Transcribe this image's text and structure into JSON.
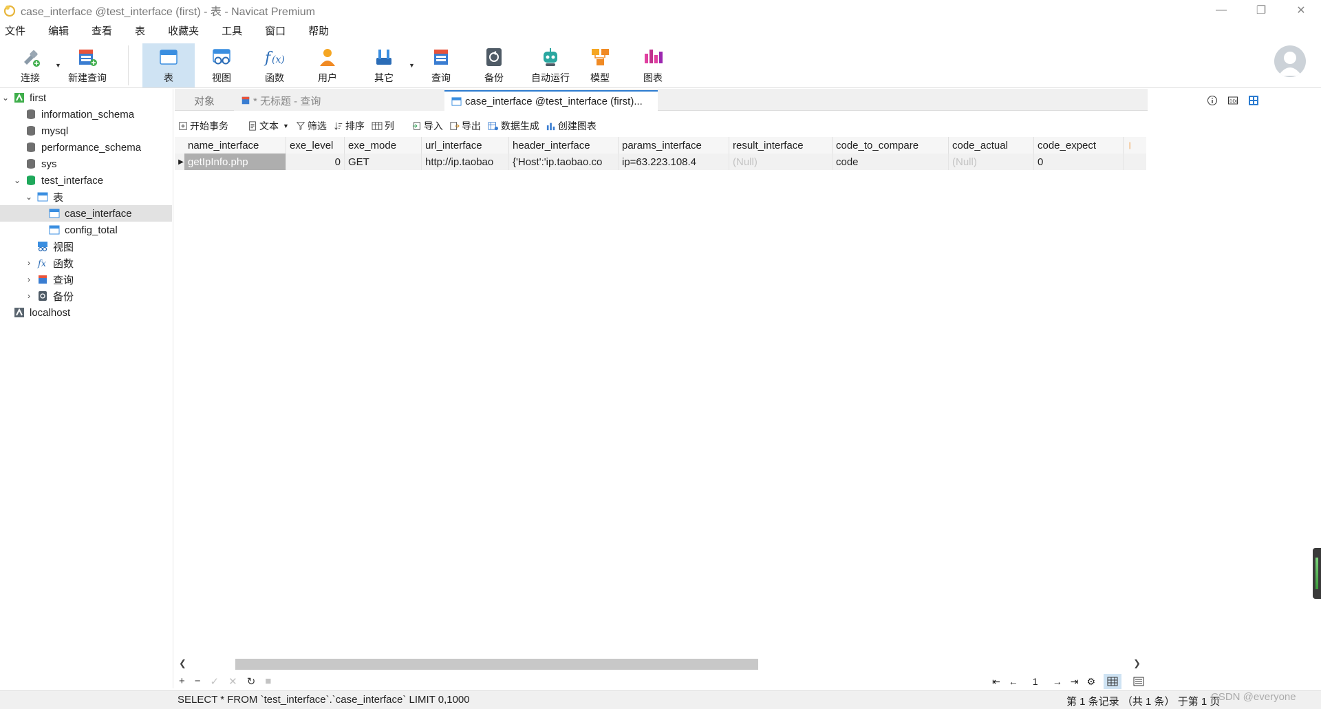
{
  "window": {
    "title": "case_interface @test_interface (first) - 表 - Navicat Premium",
    "controls": [
      "minimize",
      "restore",
      "close"
    ]
  },
  "menu": [
    "文件",
    "编辑",
    "查看",
    "表",
    "收藏夹",
    "工具",
    "窗口",
    "帮助"
  ],
  "toolbar": {
    "connect": "连接",
    "new_query": "新建查询",
    "table": "表",
    "view": "视图",
    "function": "函数",
    "user": "用户",
    "other": "其它",
    "query": "查询",
    "backup": "备份",
    "auto_run": "自动运行",
    "model": "模型",
    "chart": "图表"
  },
  "sidebar": {
    "nodes": [
      {
        "label": "first",
        "icon": "connection-icon",
        "expanded": true
      },
      {
        "label": "information_schema",
        "icon": "database-icon"
      },
      {
        "label": "mysql",
        "icon": "database-icon"
      },
      {
        "label": "performance_schema",
        "icon": "database-icon"
      },
      {
        "label": "sys",
        "icon": "database-icon"
      },
      {
        "label": "test_interface",
        "icon": "database-icon",
        "expanded": true
      },
      {
        "label": "表",
        "icon": "tables-folder-icon",
        "expanded": true
      },
      {
        "label": "case_interface",
        "icon": "table-icon",
        "selected": true
      },
      {
        "label": "config_total",
        "icon": "table-icon"
      },
      {
        "label": "视图",
        "icon": "views-folder-icon"
      },
      {
        "label": "函数",
        "icon": "functions-folder-icon"
      },
      {
        "label": "查询",
        "icon": "queries-folder-icon"
      },
      {
        "label": "备份",
        "icon": "backups-folder-icon"
      },
      {
        "label": "localhost",
        "icon": "connection-icon"
      }
    ]
  },
  "tabs": {
    "objects": "对象",
    "untitled": "* 无标题 - 查询",
    "active": "case_interface @test_interface (first)..."
  },
  "subtoolbar": {
    "begin_transaction": "开始事务",
    "text": "文本",
    "filter": "筛选",
    "sort": "排序",
    "columns": "列",
    "import": "导入",
    "export": "导出",
    "data_generation": "数据生成",
    "create_chart": "创建图表"
  },
  "grid": {
    "columns": [
      "name_interface",
      "exe_level",
      "exe_mode",
      "url_interface",
      "header_interface",
      "params_interface",
      "result_interface",
      "code_to_compare",
      "code_actual",
      "code_expect"
    ],
    "rows": [
      [
        "getIpInfo.php",
        "0",
        "GET",
        "http://ip.taobao",
        "{'Host':'ip.taobao.co",
        "ip=63.223.108.4",
        "(Null)",
        "code",
        "(Null)",
        "0"
      ]
    ]
  },
  "pager": {
    "page": "1"
  },
  "status": {
    "sql": "SELECT * FROM `test_interface`.`case_interface` LIMIT 0,1000",
    "records": "第 1 条记录 （共 1 条） 于第 1 页",
    "watermark": "CSDN @everyone"
  },
  "colors": {
    "accent": "#2c7bd0",
    "selected_tab_bg": "#cfe3f3",
    "selected_cell_bg": "#aeaeae",
    "null_text": "#c4c4c4"
  }
}
